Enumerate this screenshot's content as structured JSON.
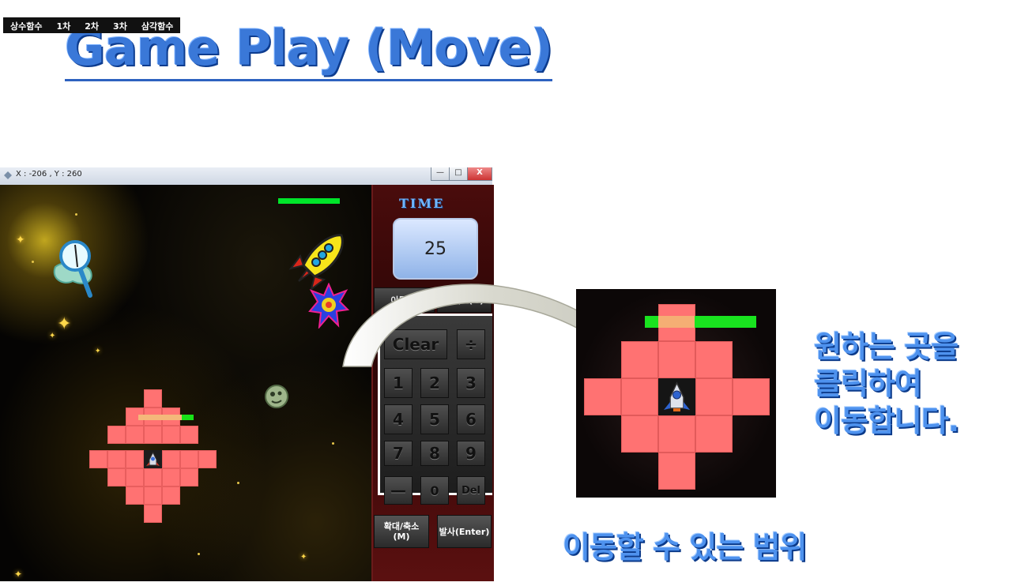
{
  "slide": {
    "title": "Game Play (Move)"
  },
  "window": {
    "coord_text": "X : -206 , Y : 260",
    "minimize_label": "—",
    "maximize_label": "□",
    "close_label": "X"
  },
  "menu": {
    "items": [
      {
        "label": "상수함수"
      },
      {
        "label": "1차"
      },
      {
        "label": "2차"
      },
      {
        "label": "3차"
      },
      {
        "label": "삼각함수"
      }
    ]
  },
  "panel": {
    "time_label": "TIME",
    "time_value": "25",
    "tab_left_label": "이동(I)",
    "tab_right_label": "그래프(G)",
    "keys": {
      "clear": "Clear",
      "divide": "÷",
      "k1": "1",
      "k2": "2",
      "k3": "3",
      "k4": "4",
      "k5": "5",
      "k6": "6",
      "k7": "7",
      "k8": "8",
      "k9": "9",
      "minus": "—",
      "zero": "0",
      "del": "Del"
    },
    "zoom_button": "확대/축소\n(M)",
    "fire_button": "발사(Enter)"
  },
  "callouts": {
    "instruction_line1": "원하는 곳을",
    "instruction_line2": "클릭하여",
    "instruction_line3": "이동합니다.",
    "range_label": "이동할 수 있는 범위"
  },
  "colors": {
    "tile": "#ff7272",
    "hp_bar": "#19e31f",
    "title_blue": "#3a78d8"
  }
}
